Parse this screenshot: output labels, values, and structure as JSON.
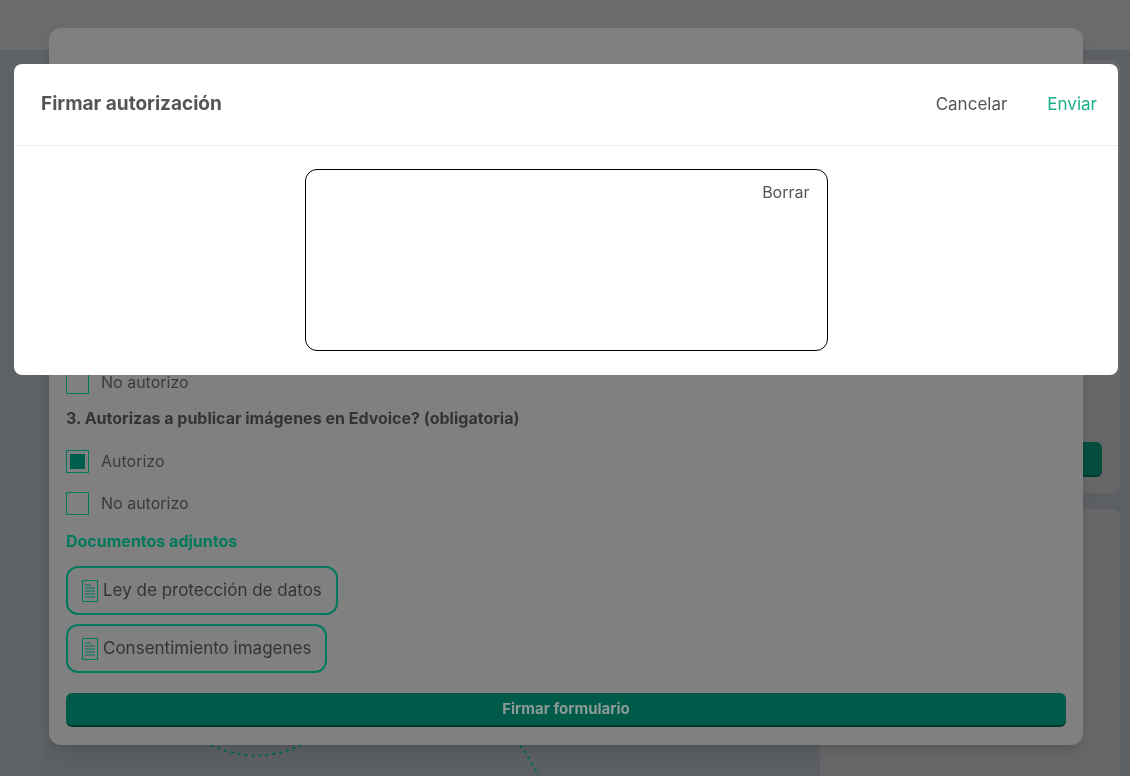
{
  "background_form": {
    "questions": [
      {
        "options": [
          {
            "label": "No autorizo",
            "checked": false
          }
        ]
      },
      {
        "title": "3. Autorizas a publicar imágenes en Edvoice? (obligatoria)",
        "options": [
          {
            "label": "Autorizo",
            "checked": true
          },
          {
            "label": "No autorizo",
            "checked": false
          }
        ]
      }
    ],
    "attachments_title": "Documentos adjuntos",
    "attachments": [
      "Ley de protección de datos",
      "Consentimiento imagenes"
    ],
    "submit": "Firmar formulario"
  },
  "dialog": {
    "title": "Firmar autorización",
    "actions": [
      {
        "label": "Cancelar",
        "kind": "secondary"
      },
      {
        "label": "Enviar",
        "kind": "primary"
      }
    ],
    "signature_pad": {
      "clear": "Borrar"
    }
  }
}
